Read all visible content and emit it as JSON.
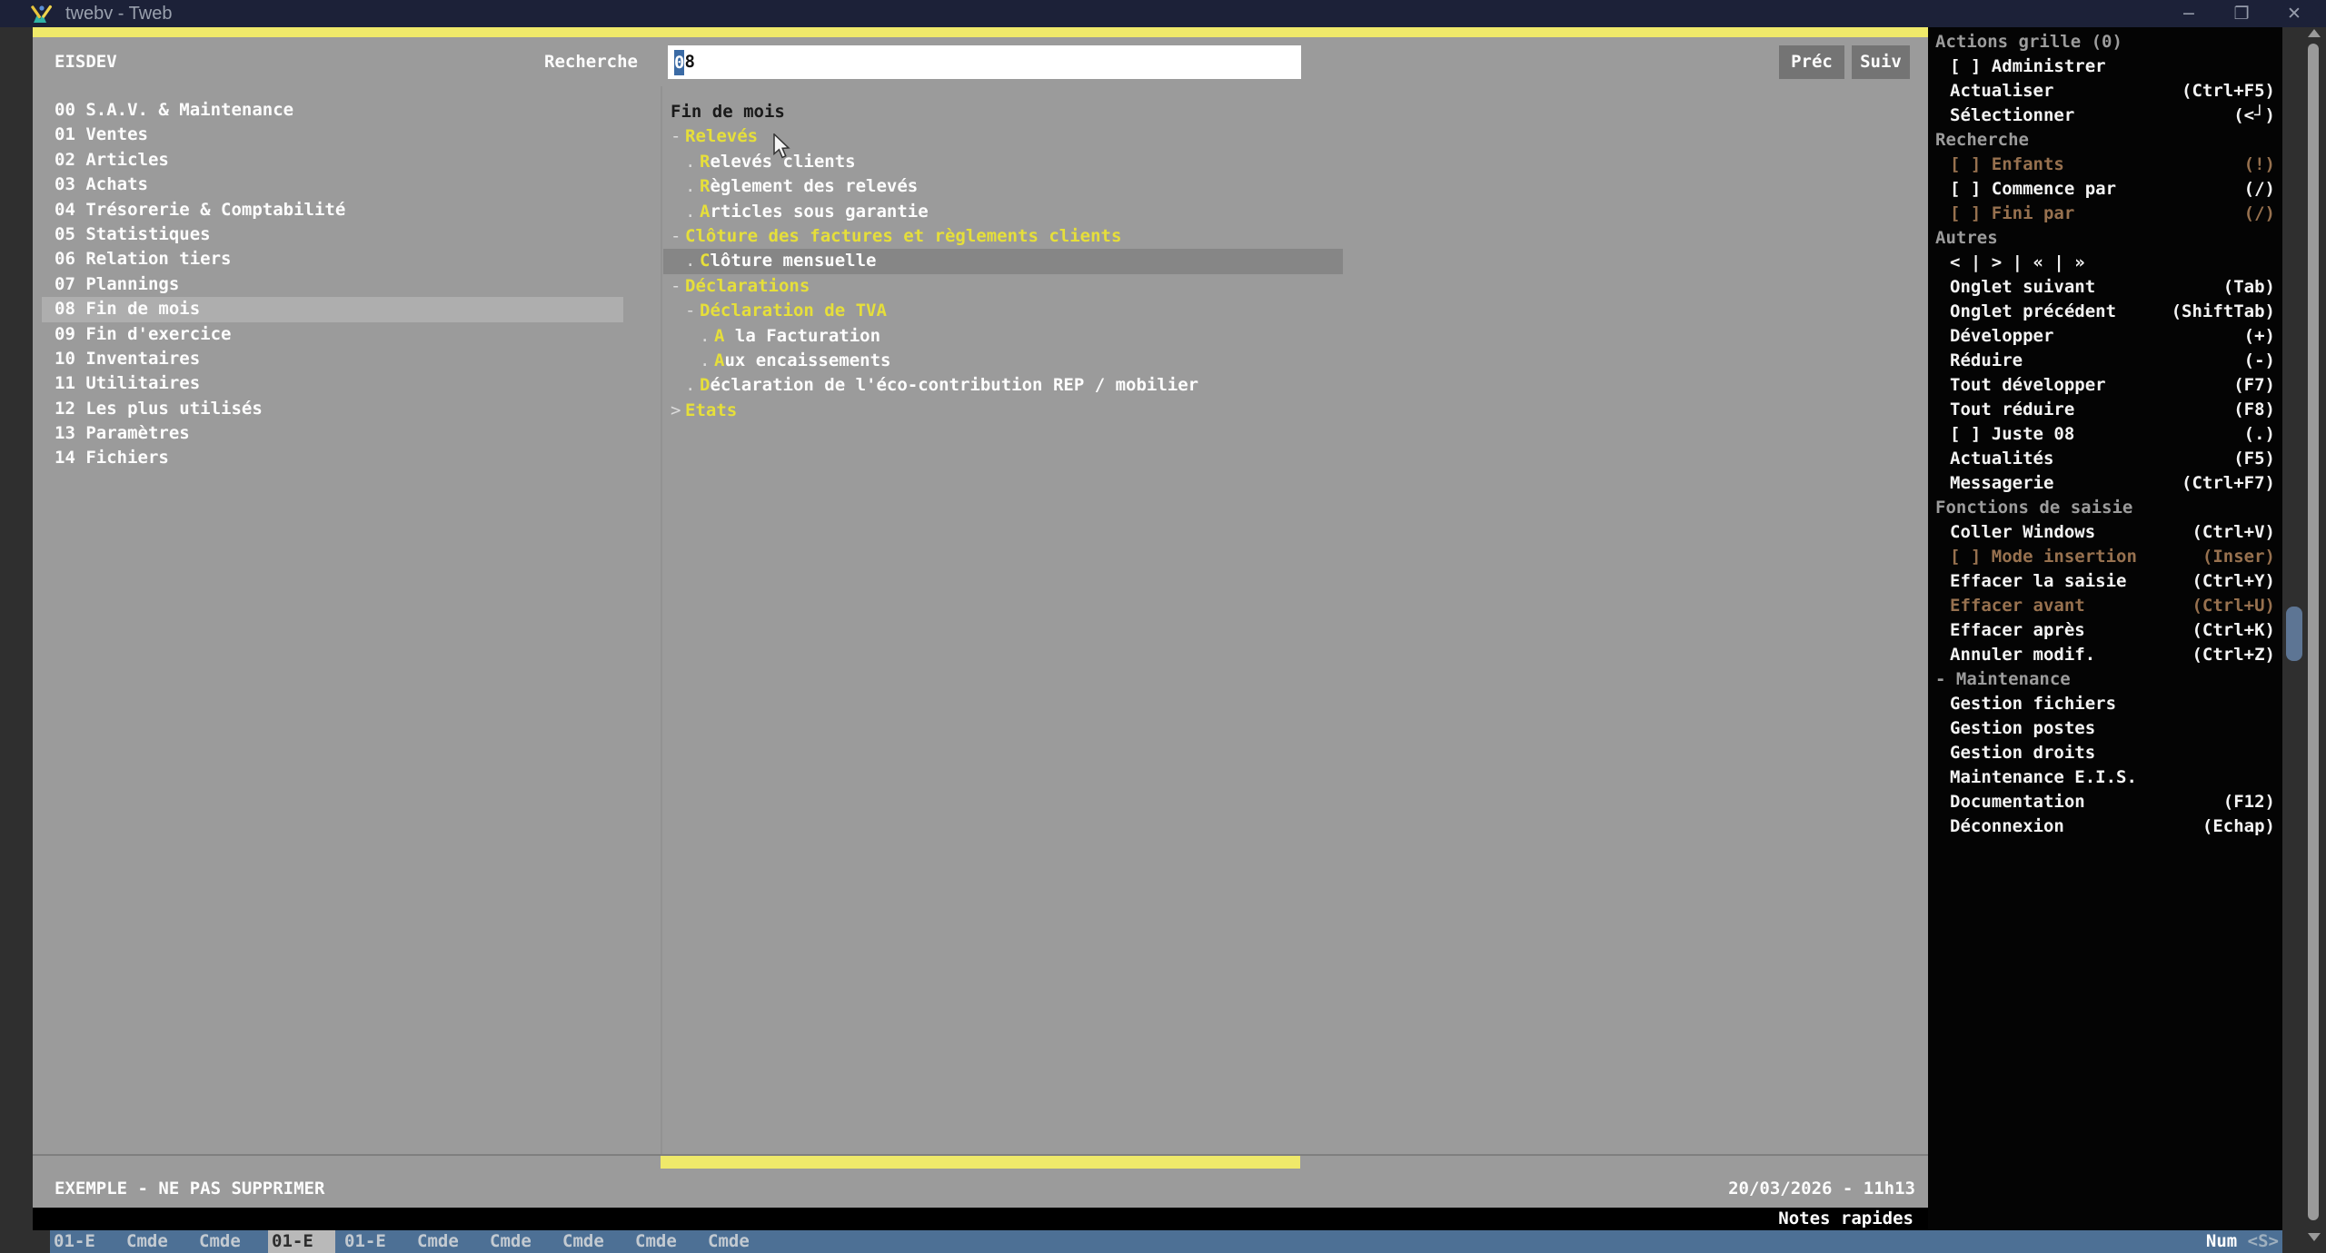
{
  "window": {
    "title": "twebv - Tweb",
    "controls": [
      {
        "name": "minimize-button",
        "glyph": "−"
      },
      {
        "name": "restore-button",
        "glyph": "❐"
      },
      {
        "name": "close-button",
        "glyph": "✕"
      }
    ]
  },
  "topbar": {
    "session": "EISDEV",
    "search_label": "Recherche",
    "search_selected": "0",
    "search_rest": "8",
    "prev_button": "Préc",
    "next_button": "Suiv"
  },
  "left_menu": {
    "selected_index": 8,
    "items": [
      "00 S.A.V. & Maintenance",
      "01 Ventes",
      "02 Articles",
      "03 Achats",
      "04 Trésorerie & Comptabilité",
      "05 Statistiques",
      "06 Relation tiers",
      "07 Plannings",
      "08 Fin de mois",
      "09 Fin d'exercice",
      "10 Inventaires",
      "11 Utilitaires",
      "12 Les plus utilisés",
      "13 Paramètres",
      "14 Fichiers"
    ]
  },
  "tree": {
    "title": "Fin de mois",
    "items": [
      {
        "indent": 0,
        "prefix": "-",
        "parent": true,
        "label": "Relevés"
      },
      {
        "indent": 1,
        "prefix": ".",
        "accel": "R",
        "rest": "elevés clients"
      },
      {
        "indent": 1,
        "prefix": ".",
        "accel": "R",
        "rest": "èglement des relevés"
      },
      {
        "indent": 1,
        "prefix": ".",
        "accel": "A",
        "rest": "rticles sous garantie"
      },
      {
        "indent": 0,
        "prefix": "-",
        "parent": true,
        "label": "Clôture des factures et règlements clients"
      },
      {
        "indent": 1,
        "prefix": ".",
        "accel": "C",
        "rest": "lôture mensuelle",
        "selected": true
      },
      {
        "indent": 0,
        "prefix": "-",
        "parent": true,
        "label": "Déclarations"
      },
      {
        "indent": 1,
        "prefix": "-",
        "parent": true,
        "label": "Déclaration de TVA"
      },
      {
        "indent": 2,
        "prefix": ".",
        "accel": "A",
        "rest": " la Facturation"
      },
      {
        "indent": 2,
        "prefix": ".",
        "accel": "A",
        "rest": "ux encaissements"
      },
      {
        "indent": 1,
        "prefix": ".",
        "accel": "D",
        "rest": "éclaration de l'éco-contribution REP / mobilier"
      },
      {
        "indent": 0,
        "prefix": ">",
        "parent": true,
        "label": "Etats"
      }
    ]
  },
  "actions_panel": {
    "sections": [
      {
        "header": "Actions grille (0)",
        "items": [
          {
            "label": "[ ] Administrer",
            "shortcut": ""
          },
          {
            "label": "Actualiser",
            "shortcut": "(Ctrl+F5)"
          },
          {
            "label": "Sélectionner",
            "shortcut": "(<┘)"
          }
        ]
      },
      {
        "header": "Recherche",
        "items": [
          {
            "label": "[ ] Enfants",
            "shortcut": "(!)",
            "disabled": true
          },
          {
            "label": "[ ] Commence par",
            "shortcut": "(/)"
          },
          {
            "label": "[ ] Fini par",
            "shortcut": "(/)",
            "disabled": true
          }
        ]
      },
      {
        "header": "Autres",
        "items": [
          {
            "label": "< | > | « | »",
            "shortcut": ""
          },
          {
            "label": "Onglet suivant",
            "shortcut": "(Tab)"
          },
          {
            "label": "Onglet précédent",
            "shortcut": "(ShiftTab)"
          },
          {
            "label": "Développer",
            "shortcut": "(+)"
          },
          {
            "label": "Réduire",
            "shortcut": "(-)"
          },
          {
            "label": "Tout développer",
            "shortcut": "(F7)"
          },
          {
            "label": "Tout réduire",
            "shortcut": "(F8)"
          },
          {
            "label": "[ ] Juste 08",
            "shortcut": "(.)"
          },
          {
            "label": "Actualités",
            "shortcut": "(F5)"
          },
          {
            "label": "Messagerie",
            "shortcut": "(Ctrl+F7)"
          }
        ]
      },
      {
        "header": "Fonctions de saisie",
        "items": [
          {
            "label": "Coller Windows",
            "shortcut": "(Ctrl+V)"
          },
          {
            "label": "[ ] Mode insertion",
            "shortcut": "(Inser)",
            "disabled": true
          },
          {
            "label": "Effacer la saisie",
            "shortcut": "(Ctrl+Y)"
          },
          {
            "label": "Effacer avant",
            "shortcut": "(Ctrl+U)",
            "disabled": true
          },
          {
            "label": "Effacer après",
            "shortcut": "(Ctrl+K)"
          },
          {
            "label": "Annuler modif.",
            "shortcut": "(Ctrl+Z)"
          }
        ]
      },
      {
        "header": "- Maintenance",
        "items": [
          {
            "label": "Gestion fichiers",
            "shortcut": ""
          },
          {
            "label": "Gestion postes",
            "shortcut": ""
          },
          {
            "label": "Gestion droits",
            "shortcut": ""
          },
          {
            "label": "Maintenance E.I.S.",
            "shortcut": ""
          },
          {
            "label": "Documentation",
            "shortcut": "(F12)"
          },
          {
            "label": "Déconnexion",
            "shortcut": "(Echap)"
          }
        ]
      }
    ]
  },
  "status": {
    "message": "EXEMPLE - NE PAS SUPPRIMER",
    "datetime": "20/03/2026 - 11h13",
    "notes": "Notes rapides"
  },
  "taskbar": {
    "active_index": 3,
    "tabs": [
      "01-E",
      "Cmde",
      "Cmde",
      "01-E",
      "01-E",
      "Cmde",
      "Cmde",
      "Cmde",
      "Cmde",
      "Cmde"
    ],
    "num": "Num",
    "indicator": "<S>"
  },
  "colors": {
    "accent_yellow": "#efe96a",
    "tree_yellow_text": "#e6df3a",
    "panel_gray": "#9b9b9b",
    "titlebar_navy": "#1c2138",
    "taskbar_blue": "#4d7095",
    "disabled_brown": "#97714f",
    "selection_blue": "#3b6ba5",
    "panel_black": "#040404"
  }
}
